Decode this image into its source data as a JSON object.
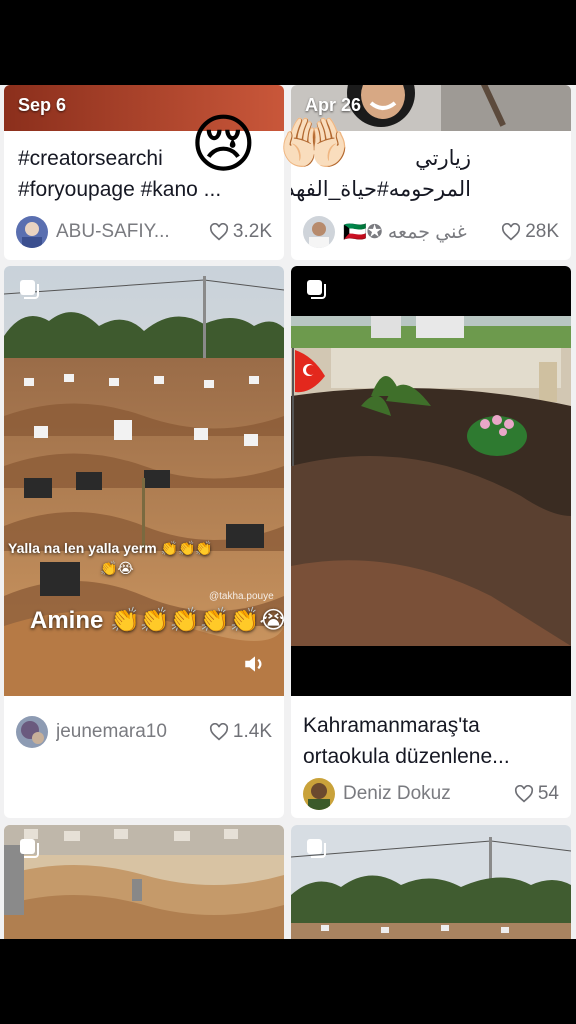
{
  "feed": {
    "cards": [
      {
        "date": "Sep 6",
        "caption_line1": "#creatorsearchi",
        "caption_line2": "#foryoupage #kano ...",
        "username": "ABU-SAFIY...",
        "likes": "3.2K"
      },
      {
        "date": "Apr 26",
        "caption_line1": "زيارتي",
        "caption_line2": "المرحومه#حياة_الفهد",
        "username": "غني جمعه ✪🇰🇼",
        "likes": "28K"
      },
      {
        "overlay_line1": "Yalla na len yalla yerm 👏👏👏",
        "overlay_line2": "👏😭",
        "overlay_big": "Amine 👏👏👏👏👏😭",
        "watermark": "@takha.pouye",
        "username": "jeunemara10",
        "likes": "1.4K"
      },
      {
        "caption_line1": "Kahramanmaraş'ta",
        "caption_line2": "ortaokula düzenlene...",
        "username": "Deniz Dokuz",
        "likes": "54"
      }
    ],
    "overlay_emojis": {
      "crying": "😢",
      "praying_hands": "🤲🏻"
    }
  }
}
